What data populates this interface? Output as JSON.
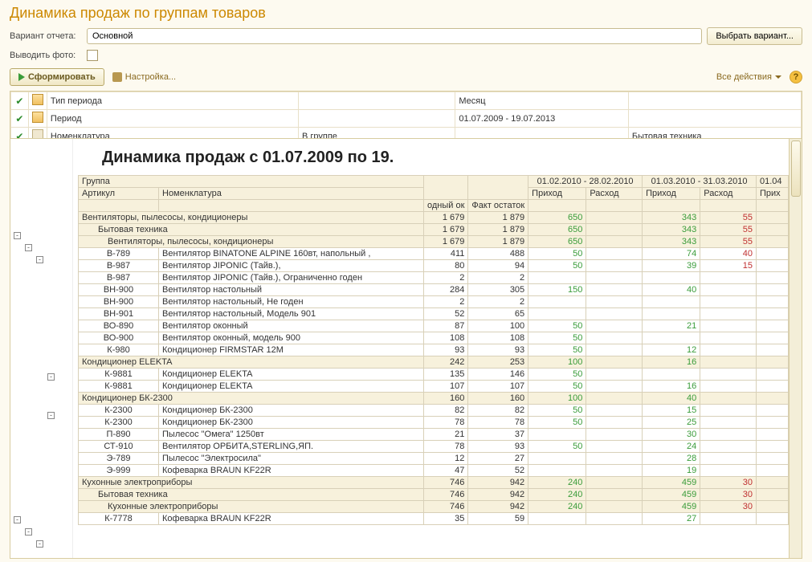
{
  "title": "Динамика продаж по группам товаров",
  "form": {
    "variant_label": "Вариант отчета:",
    "variant_value": "Основной",
    "select_variant_btn": "Выбрать вариант...",
    "photo_label": "Выводить фото:"
  },
  "toolbar": {
    "generate": "Сформировать",
    "settings": "Настройка...",
    "all_actions": "Все действия"
  },
  "filters": [
    {
      "label": "Тип периода",
      "col2": "",
      "col3": "Месяц",
      "col4": ""
    },
    {
      "label": "Период",
      "col2": "",
      "col3": "01.07.2009 - 19.07.2013",
      "col4": ""
    },
    {
      "label": "Номенклатура",
      "col2": "В группе",
      "col3": "",
      "col4": "Бытовая техника"
    }
  ],
  "report": {
    "heading": "Динамика продаж с 01.07.2009 по 19.",
    "head": {
      "group": "Группа",
      "article": "Артикул",
      "nomen": "Номенклатура",
      "col1": "одный ок",
      "col2": "Факт остаток",
      "period1": "01.02.2010 - 28.02.2010",
      "period2": "01.03.2010 - 31.03.2010",
      "period3": "01.04",
      "in": "Приход",
      "out": "Расход",
      "in3": "Прих"
    },
    "rows": [
      {
        "type": "grp",
        "art": "",
        "name": "Вентиляторы, пылесосы, кондиционеры",
        "c1": "1 679",
        "c2": "1 879",
        "p1i": "650",
        "p1o": "",
        "p2i": "343",
        "p2o": "55"
      },
      {
        "type": "grp",
        "indent": 1,
        "art": "",
        "name": "Бытовая техника",
        "c1": "1 679",
        "c2": "1 879",
        "p1i": "650",
        "p1o": "",
        "p2i": "343",
        "p2o": "55"
      },
      {
        "type": "grp",
        "indent": 2,
        "art": "",
        "name": "Вентиляторы, пылесосы, кондиционеры",
        "c1": "1 679",
        "c2": "1 879",
        "p1i": "650",
        "p1o": "",
        "p2i": "343",
        "p2o": "55"
      },
      {
        "art": "В-789",
        "name": "Вентилятор BINATONE ALPINE 160вт, напольный ,",
        "c1": "411",
        "c2": "488",
        "p1i": "50",
        "p1o": "",
        "p2i": "74",
        "p2o": "40"
      },
      {
        "art": "В-987",
        "name": "Вентилятор JIPONIC (Тайв.),",
        "c1": "80",
        "c2": "94",
        "p1i": "50",
        "p1o": "",
        "p2i": "39",
        "p2o": "15"
      },
      {
        "art": "В-987",
        "name": "Вентилятор JIPONIC (Тайв.), Ограниченно годен",
        "c1": "2",
        "c2": "2",
        "p1i": "",
        "p1o": "",
        "p2i": "",
        "p2o": ""
      },
      {
        "art": "ВН-900",
        "name": "Вентилятор настольный",
        "c1": "284",
        "c2": "305",
        "p1i": "150",
        "p1o": "",
        "p2i": "40",
        "p2o": ""
      },
      {
        "art": "ВН-900",
        "name": "Вентилятор настольный, Не годен",
        "c1": "2",
        "c2": "2",
        "p1i": "",
        "p1o": "",
        "p2i": "",
        "p2o": ""
      },
      {
        "art": "ВН-901",
        "name": "Вентилятор настольный, Модель 901",
        "c1": "52",
        "c2": "65",
        "p1i": "",
        "p1o": "",
        "p2i": "",
        "p2o": ""
      },
      {
        "art": "ВО-890",
        "name": "Вентилятор оконный",
        "c1": "87",
        "c2": "100",
        "p1i": "50",
        "p1o": "",
        "p2i": "21",
        "p2o": ""
      },
      {
        "art": "ВО-900",
        "name": "Вентилятор оконный, модель 900",
        "c1": "108",
        "c2": "108",
        "p1i": "50",
        "p1o": "",
        "p2i": "",
        "p2o": ""
      },
      {
        "art": "К-980",
        "name": "Кондиционер FIRMSTAR 12M",
        "c1": "93",
        "c2": "93",
        "p1i": "50",
        "p1o": "",
        "p2i": "12",
        "p2o": ""
      },
      {
        "type": "sub",
        "art": "",
        "name": "Кондиционер ELEKTA",
        "c1": "242",
        "c2": "253",
        "p1i": "100",
        "p1o": "",
        "p2i": "16",
        "p2o": ""
      },
      {
        "art": "К-9881",
        "name": "Кондиционер ELEKTA",
        "c1": "135",
        "c2": "146",
        "p1i": "50",
        "p1o": "",
        "p2i": "",
        "p2o": ""
      },
      {
        "art": "К-9881",
        "name": "Кондиционер ELEKTA",
        "c1": "107",
        "c2": "107",
        "p1i": "50",
        "p1o": "",
        "p2i": "16",
        "p2o": ""
      },
      {
        "type": "sub",
        "art": "",
        "name": "Кондиционер БК-2300",
        "c1": "160",
        "c2": "160",
        "p1i": "100",
        "p1o": "",
        "p2i": "40",
        "p2o": ""
      },
      {
        "art": "К-2300",
        "name": "Кондиционер БК-2300",
        "c1": "82",
        "c2": "82",
        "p1i": "50",
        "p1o": "",
        "p2i": "15",
        "p2o": ""
      },
      {
        "art": "К-2300",
        "name": "Кондиционер БК-2300",
        "c1": "78",
        "c2": "78",
        "p1i": "50",
        "p1o": "",
        "p2i": "25",
        "p2o": ""
      },
      {
        "art": "П-890",
        "name": "Пылесос \"Омега\" 1250вт",
        "c1": "21",
        "c2": "37",
        "p1i": "",
        "p1o": "",
        "p2i": "30",
        "p2o": ""
      },
      {
        "art": "СТ-910",
        "name": "Вентилятор ОРБИТА,STERLING,ЯП.",
        "c1": "78",
        "c2": "93",
        "p1i": "50",
        "p1o": "",
        "p2i": "24",
        "p2o": ""
      },
      {
        "art": "Э-789",
        "name": "Пылесос \"Электросила\"",
        "c1": "12",
        "c2": "27",
        "p1i": "",
        "p1o": "",
        "p2i": "28",
        "p2o": ""
      },
      {
        "art": "Э-999",
        "name": "Кофеварка BRAUN KF22R",
        "c1": "47",
        "c2": "52",
        "p1i": "",
        "p1o": "",
        "p2i": "19",
        "p2o": ""
      },
      {
        "type": "grp",
        "art": "",
        "name": "Кухонные электроприборы",
        "c1": "746",
        "c2": "942",
        "p1i": "240",
        "p1o": "",
        "p2i": "459",
        "p2o": "30"
      },
      {
        "type": "grp",
        "indent": 1,
        "art": "",
        "name": "Бытовая техника",
        "c1": "746",
        "c2": "942",
        "p1i": "240",
        "p1o": "",
        "p2i": "459",
        "p2o": "30"
      },
      {
        "type": "grp",
        "indent": 2,
        "art": "",
        "name": "Кухонные электроприборы",
        "c1": "746",
        "c2": "942",
        "p1i": "240",
        "p1o": "",
        "p2i": "459",
        "p2o": "30"
      },
      {
        "art": "К-7778",
        "name": "Кофеварка BRAUN KF22R",
        "c1": "35",
        "c2": "59",
        "p1i": "",
        "p1o": "",
        "p2i": "27",
        "p2o": ""
      }
    ]
  }
}
